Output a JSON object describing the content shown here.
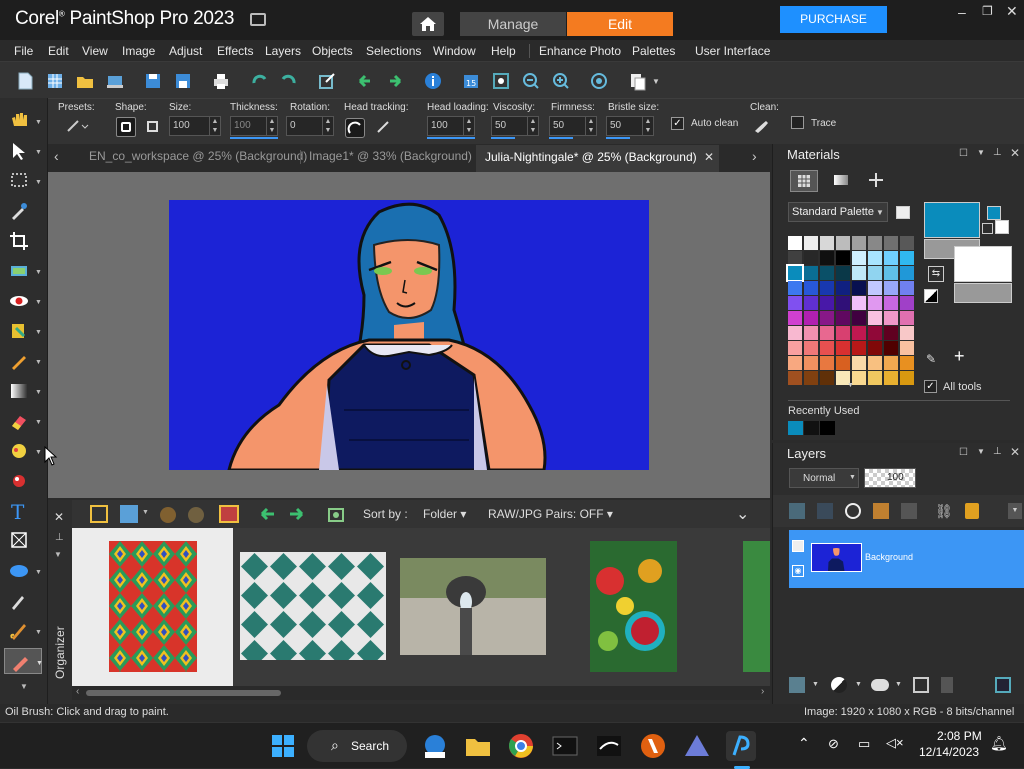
{
  "app": {
    "brand": "Corel",
    "name": "PaintShop Pro 2023"
  },
  "workspace_tabs": [
    {
      "label": "Manage",
      "active": false
    },
    {
      "label": "Edit",
      "active": true
    }
  ],
  "purchase_label": "PURCHASE",
  "colors": {
    "accent": "#f47b20",
    "purchase": "#1e90ff",
    "selection": "#3c96f5",
    "foreground": "#0a8cbc",
    "background": "#ffffff"
  },
  "menu": [
    "File",
    "Edit",
    "View",
    "Image",
    "Adjust",
    "Effects",
    "Layers",
    "Objects",
    "Selections",
    "Window",
    "Help",
    "Enhance Photo",
    "Palettes",
    "User Interface"
  ],
  "options": {
    "presets_label": "Presets:",
    "shape_label": "Shape:",
    "size_label": "Size:",
    "size_value": "100",
    "thickness_label": "Thickness:",
    "thickness_value": "100",
    "rotation_label": "Rotation:",
    "rotation_value": "0",
    "head_tracking_label": "Head tracking:",
    "head_loading_label": "Head loading:",
    "head_loading_value": "100",
    "viscosity_label": "Viscosity:",
    "viscosity_value": "50",
    "firmness_label": "Firmness:",
    "firmness_value": "50",
    "bristle_label": "Bristle size:",
    "bristle_value": "50",
    "auto_clean_label": "Auto clean",
    "auto_clean_checked": true,
    "clean_label": "Clean:",
    "trace_label": "Trace",
    "trace_checked": false
  },
  "doc_tabs": [
    {
      "label": "EN_co_workspace @  25% (Background)",
      "active": false
    },
    {
      "label": "Image1* @  33% (Background)",
      "active": false
    },
    {
      "label": "Julia-Nightingale* @  25% (Background)",
      "active": true
    }
  ],
  "organizer": {
    "title": "Organizer",
    "sort_label": "Sort by :",
    "sort_value": "Folder",
    "raw_label": "RAW/JPG Pairs: OFF"
  },
  "materials": {
    "title": "Materials",
    "palette_select": "Standard Palette",
    "all_tools_label": "All tools",
    "all_tools_checked": true,
    "recently_used_label": "Recently Used",
    "swatches": [
      "#ffffff",
      "#eeeeee",
      "#d8d8d8",
      "#bcbcbc",
      "#a0a0a0",
      "#888888",
      "#707070",
      "#585858",
      "#404040",
      "#282828",
      "#101010",
      "#000000",
      "#d0f0ff",
      "#a8e4ff",
      "#70d0ff",
      "#30b8f0",
      "#0a8cbc",
      "#0a6e94",
      "#0a5068",
      "#0a3848",
      "#c0e8f8",
      "#90d4f0",
      "#60c0e8",
      "#2098d8",
      "#3c78f0",
      "#2858d8",
      "#1838b0",
      "#102080",
      "#081050",
      "#c0c8ff",
      "#98a8f8",
      "#7080f0",
      "#8050f0",
      "#6030d0",
      "#4818a8",
      "#301078",
      "#f0c0f8",
      "#e098f0",
      "#c868e0",
      "#a040c8",
      "#d040d0",
      "#b020b0",
      "#881888",
      "#600860",
      "#400040",
      "#f8c0e0",
      "#f098c8",
      "#e070b0",
      "#f8b8d0",
      "#f090b0",
      "#e86890",
      "#d84070",
      "#c01850",
      "#900838",
      "#600020",
      "#f8c8c8",
      "#f8a0a0",
      "#f07878",
      "#e85050",
      "#d83030",
      "#b81818",
      "#800808",
      "#500000",
      "#f8c0a0",
      "#f8a880",
      "#f09060",
      "#e87840",
      "#d86020",
      "#f8d8a8",
      "#f8c080",
      "#f0a850",
      "#e89020",
      "#a05020",
      "#804010",
      "#603008",
      "#f8e8b8",
      "#f8d890",
      "#f0c860",
      "#e8b030",
      "#d89810"
    ],
    "recent": [
      "#0a8cbc",
      "#111111",
      "#000000"
    ]
  },
  "layers": {
    "title": "Layers",
    "blend_mode": "Normal",
    "opacity": "100",
    "layer_name": "Background"
  },
  "status": {
    "hint": "Oil Brush: Click and drag to paint.",
    "image_info": "Image:  1920 x 1080 x RGB - 8 bits/channel"
  },
  "taskbar": {
    "search_label": "Search",
    "time": "2:08 PM",
    "date": "12/14/2023"
  }
}
